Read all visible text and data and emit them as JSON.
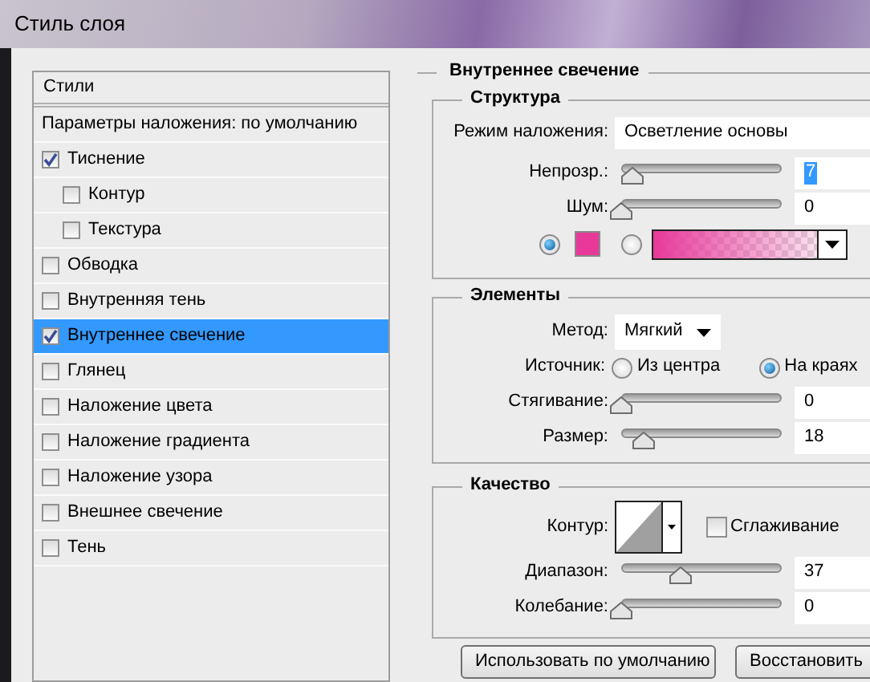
{
  "window": {
    "title": "Стиль слоя"
  },
  "styles_list": {
    "header": "Стили",
    "blending_options": "Параметры наложения: по умолчанию",
    "items": [
      {
        "label": "Тиснение",
        "checked": true,
        "selected": false,
        "children": [
          {
            "label": "Контур",
            "checked": false,
            "selected": false
          },
          {
            "label": "Текстура",
            "checked": false,
            "selected": false
          }
        ]
      },
      {
        "label": "Обводка",
        "checked": false,
        "selected": false
      },
      {
        "label": "Внутренняя тень",
        "checked": false,
        "selected": false
      },
      {
        "label": "Внутреннее свечение",
        "checked": true,
        "selected": true
      },
      {
        "label": "Глянец",
        "checked": false,
        "selected": false
      },
      {
        "label": "Наложение цвета",
        "checked": false,
        "selected": false
      },
      {
        "label": "Наложение градиента",
        "checked": false,
        "selected": false
      },
      {
        "label": "Наложение узора",
        "checked": false,
        "selected": false
      },
      {
        "label": "Внешнее свечение",
        "checked": false,
        "selected": false
      },
      {
        "label": "Тень",
        "checked": false,
        "selected": false
      }
    ]
  },
  "inner_glow": {
    "title": "Внутреннее свечение",
    "structure": {
      "title": "Структура",
      "blend_mode": {
        "label": "Режим наложения:",
        "value": "Осветление основы"
      },
      "sliders": [
        {
          "label": "Непрозр.:",
          "level": 0.07,
          "value": "7",
          "value_highlighted": true
        },
        {
          "label": "Шум:",
          "level": 0,
          "value": "0",
          "value_highlighted": false
        }
      ],
      "fill": {
        "color_selected": true,
        "gradient_selected": false
      }
    },
    "elements": {
      "title": "Элементы",
      "method": {
        "label": "Метод:",
        "value": "Мягкий"
      },
      "source": {
        "label": "Источник:",
        "options": [
          {
            "label": "Из центра",
            "selected": false
          },
          {
            "label": "На краях",
            "selected": true
          }
        ]
      },
      "sliders": [
        {
          "label": "Стягивание:",
          "level": 0,
          "value": "0",
          "value_highlighted": false
        },
        {
          "label": "Размер:",
          "level": 0.14,
          "value": "18",
          "value_highlighted": false
        }
      ]
    },
    "quality": {
      "title": "Качество",
      "contour": {
        "label": "Контур:"
      },
      "anti_aliased": {
        "label": "Сглаживание",
        "checked": false
      },
      "sliders": [
        {
          "label": "Диапазон:",
          "level": 0.37,
          "value": "37",
          "value_highlighted": false
        },
        {
          "label": "Колебание:",
          "level": 0,
          "value": "0",
          "value_highlighted": false
        }
      ]
    }
  },
  "buttons": [
    {
      "label": "Использовать по умолчанию"
    },
    {
      "label": "Восстановить"
    }
  ]
}
